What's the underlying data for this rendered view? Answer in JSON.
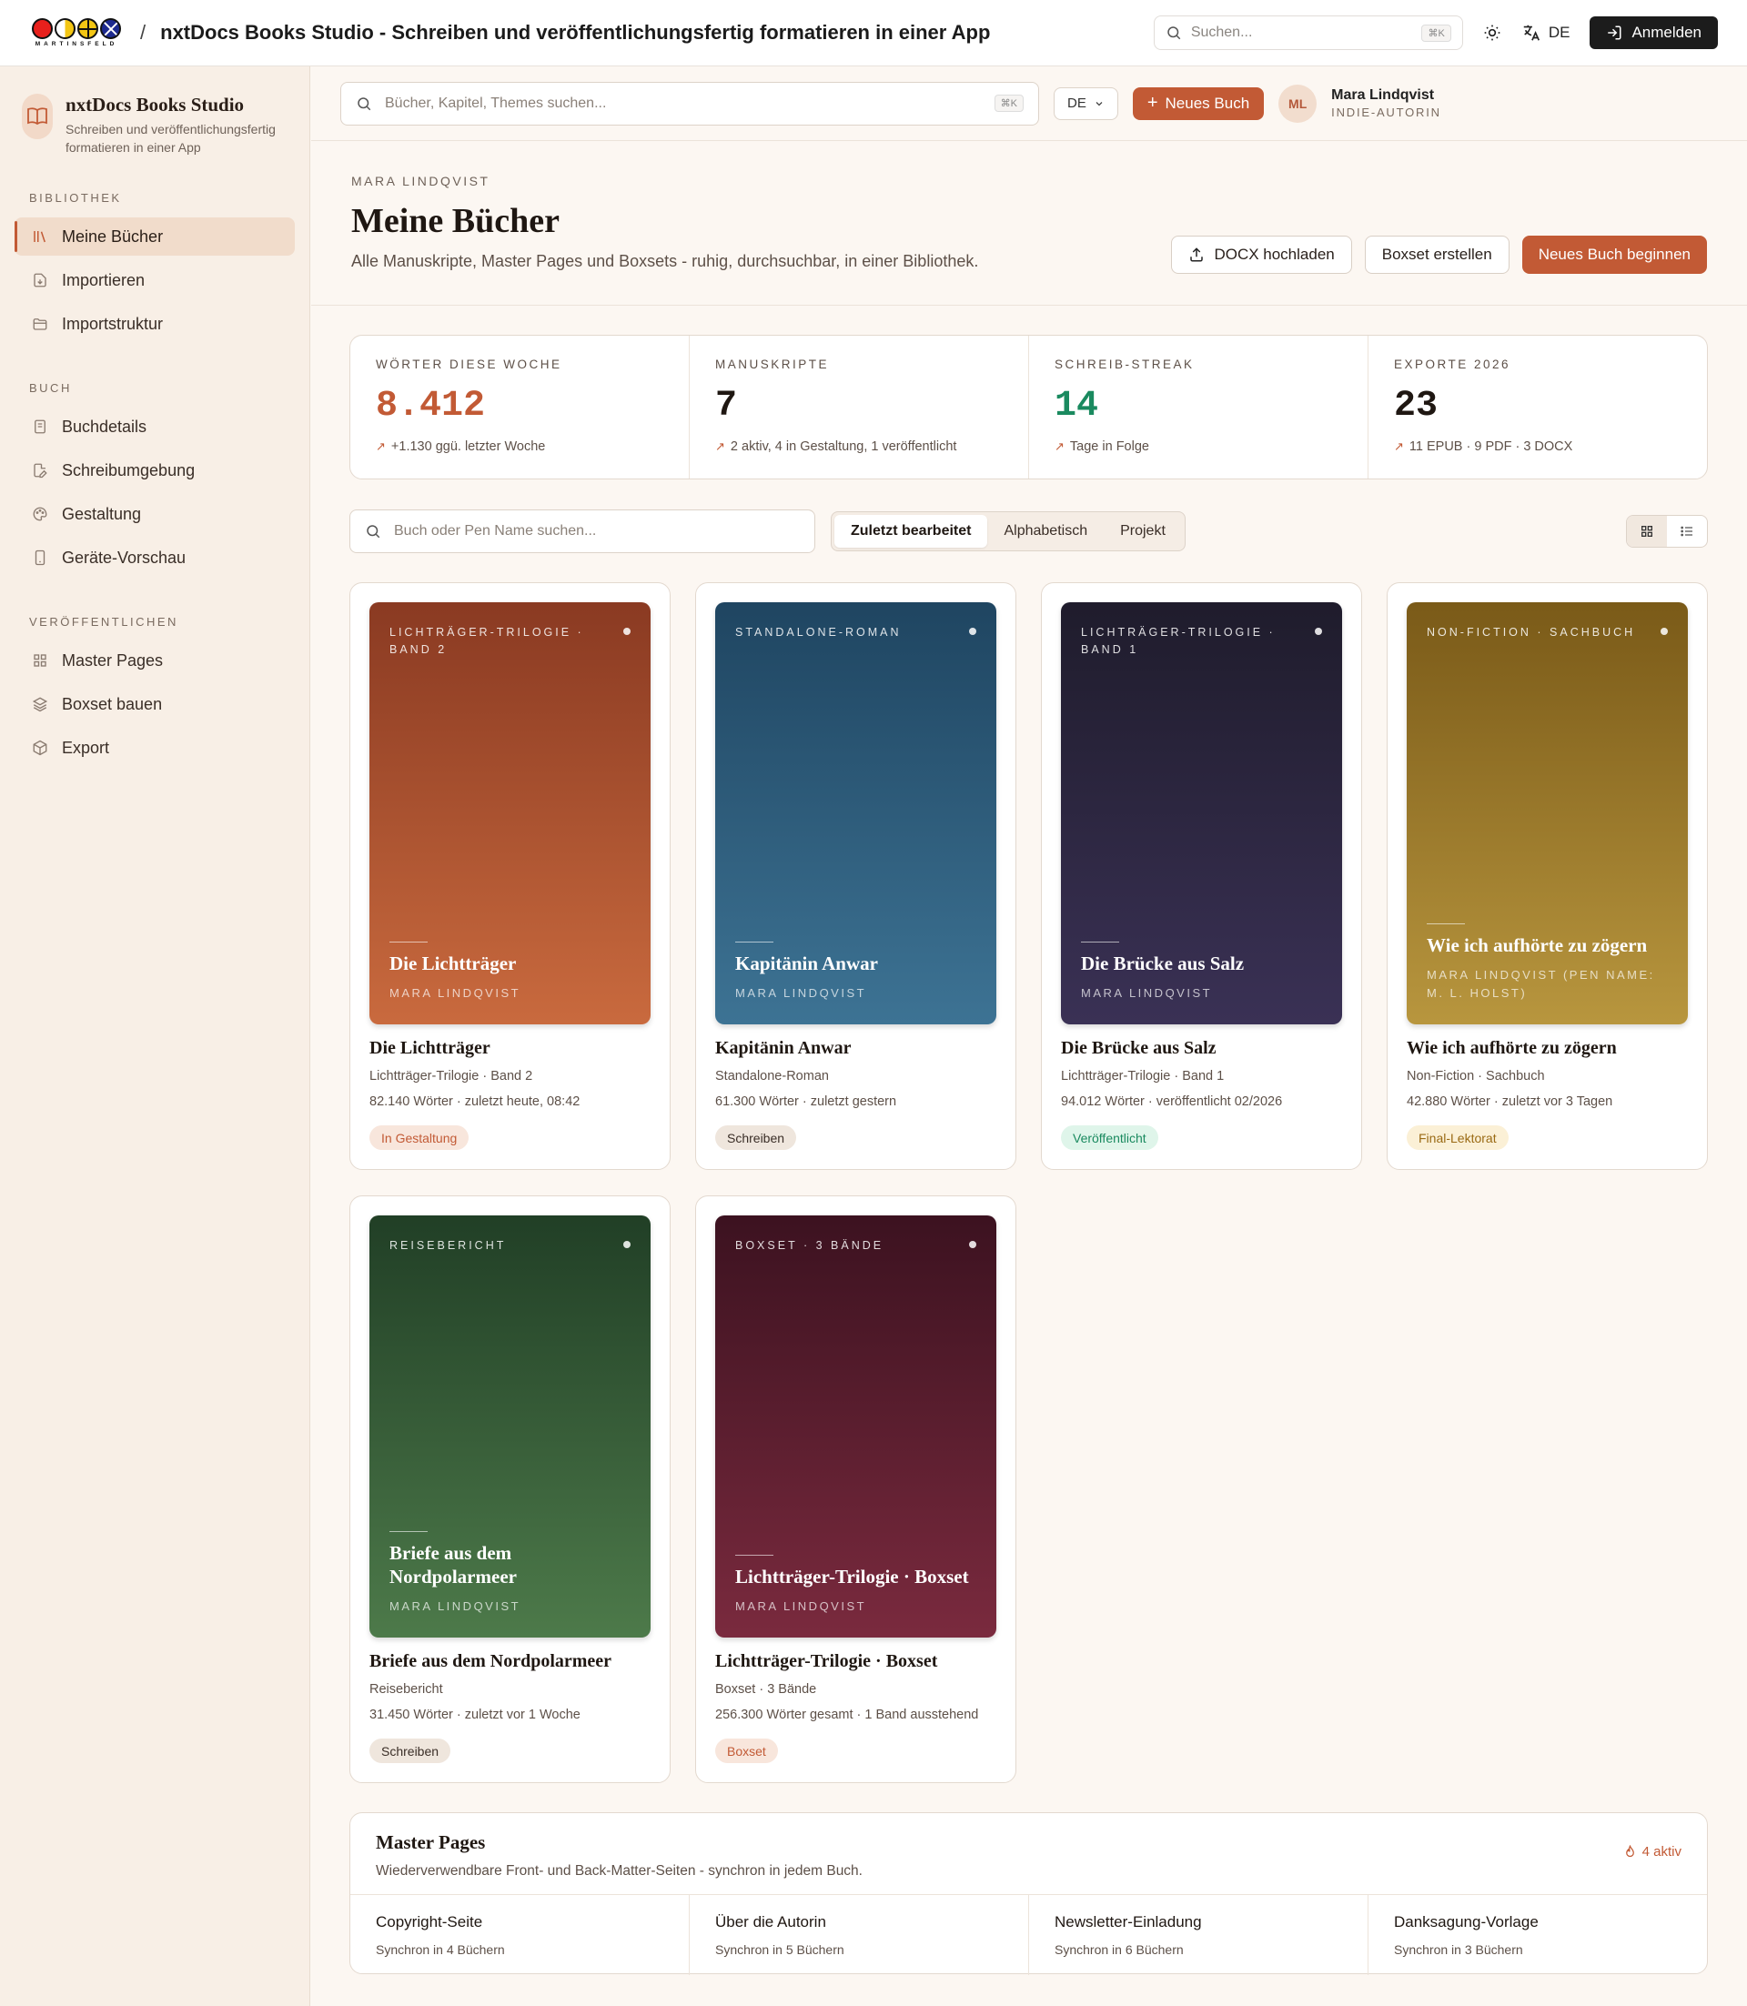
{
  "app": {
    "logo_word": "MARTINSFELD",
    "title": "nxtDocs Books Studio - Schreiben und veröffentlichungsfertig formatieren in einer App",
    "search_placeholder": "Suchen...",
    "search_kbd": "⌘K",
    "lang": "DE",
    "login_label": "Anmelden",
    "logo_colors": [
      "#e8201c",
      "#f3c614",
      "#f3c614",
      "#1d2a8f"
    ]
  },
  "sidebar": {
    "brand_name": "nxtDocs Books Studio",
    "brand_sub": "Schreiben und veröffentlichungsfertig formatieren in einer App",
    "sections": [
      {
        "heading": "BIBLIOTHEK",
        "items": [
          {
            "label": "Meine Bücher",
            "icon": "library-icon",
            "active": true
          },
          {
            "label": "Importieren",
            "icon": "file-import-icon"
          },
          {
            "label": "Importstruktur",
            "icon": "folder-open-icon"
          }
        ]
      },
      {
        "heading": "BUCH",
        "items": [
          {
            "label": "Buchdetails",
            "icon": "book-details-icon"
          },
          {
            "label": "Schreibumgebung",
            "icon": "edit-file-icon"
          },
          {
            "label": "Gestaltung",
            "icon": "palette-icon"
          },
          {
            "label": "Geräte-Vorschau",
            "icon": "device-icon"
          }
        ]
      },
      {
        "heading": "VERÖFFENTLICHEN",
        "items": [
          {
            "label": "Master Pages",
            "icon": "grid-icon"
          },
          {
            "label": "Boxset bauen",
            "icon": "layers-icon"
          },
          {
            "label": "Export",
            "icon": "package-icon"
          }
        ]
      }
    ]
  },
  "subbar": {
    "search_placeholder": "Bücher, Kapitel, Themes suchen...",
    "search_kbd": "⌘K",
    "lang": "DE",
    "new_book_label": "Neues Buch",
    "avatar_initials": "ML",
    "user_name": "Mara Lindqvist",
    "user_role": "INDIE-AUTORIN"
  },
  "header": {
    "kicker": "MARA LINDQVIST",
    "title": "Meine Bücher",
    "description": "Alle Manuskripte, Master Pages und Boxsets - ruhig, durchsuchbar, in einer Bibliothek.",
    "upload_label": "DOCX hochladen",
    "boxset_label": "Boxset erstellen",
    "new_label": "Neues Buch beginnen"
  },
  "stats": [
    {
      "label": "WÖRTER DIESE WOCHE",
      "value": "8.412",
      "note": "+1.130 ggü. letzter Woche",
      "color": "#c25a35"
    },
    {
      "label": "MANUSKRIPTE",
      "value": "7",
      "note": "2 aktiv, 4 in Gestaltung, 1 veröffentlicht",
      "color": "#1f1712"
    },
    {
      "label": "SCHREIB-STREAK",
      "value": "14",
      "note": "Tage in Folge",
      "color": "#1a8a5f"
    },
    {
      "label": "EXPORTE 2026",
      "value": "23",
      "note": "11 EPUB · 9 PDF · 3 DOCX",
      "color": "#1f1712"
    }
  ],
  "filters": {
    "search_placeholder": "Buch oder Pen Name suchen...",
    "sort_options": [
      "Zuletzt bearbeitet",
      "Alphabetisch",
      "Projekt"
    ]
  },
  "books": [
    {
      "series_label": "LICHTRÄGER-TRILOGIE · BAND 2",
      "cover_title": "Die Lichtträger",
      "cover_author": "MARA LINDQVIST",
      "title": "Die Lichtträger",
      "series": "Lichtträger-Trilogie · Band 2",
      "meta": "82.140 Wörter · zuletzt heute, 08:42",
      "status": "In Gestaltung",
      "gradient": [
        "#8a3a22",
        "#c96a3e"
      ],
      "badge_bg": "#f8e6dc",
      "badge_fg": "#c25a35"
    },
    {
      "series_label": "STANDALONE-ROMAN",
      "cover_title": "Kapitänin Anwar",
      "cover_author": "MARA LINDQVIST",
      "title": "Kapitänin Anwar",
      "series": "Standalone-Roman",
      "meta": "61.300 Wörter · zuletzt gestern",
      "status": "Schreiben",
      "gradient": [
        "#1f4561",
        "#3d7394"
      ],
      "badge_bg": "#efe6dd",
      "badge_fg": "#3a2e27"
    },
    {
      "series_label": "LICHTRÄGER-TRILOGIE · BAND 1",
      "cover_title": "Die Brücke aus Salz",
      "cover_author": "MARA LINDQVIST",
      "title": "Die Brücke aus Salz",
      "series": "Lichtträger-Trilogie · Band 1",
      "meta": "94.012 Wörter · veröffentlicht 02/2026",
      "status": "Veröffentlicht",
      "gradient": [
        "#1f1c2c",
        "#3a3155"
      ],
      "badge_bg": "#dff5ea",
      "badge_fg": "#1a8a5f"
    },
    {
      "series_label": "NON-FICTION · SACHBUCH",
      "cover_title": "Wie ich aufhörte zu zögern",
      "cover_author": "MARA LINDQVIST (PEN NAME: M. L. HOLST)",
      "title": "Wie ich aufhörte zu zögern",
      "series": "Non-Fiction · Sachbuch",
      "meta": "42.880 Wörter · zuletzt vor 3 Tagen",
      "status": "Final-Lektorat",
      "gradient": [
        "#7a5a18",
        "#b8963e"
      ],
      "badge_bg": "#fbf0d6",
      "badge_fg": "#9a6a14"
    },
    {
      "series_label": "REISEBERICHT",
      "cover_title": "Briefe aus dem Nordpolarmeer",
      "cover_author": "MARA LINDQVIST",
      "title": "Briefe aus dem Nordpolarmeer",
      "series": "Reisebericht",
      "meta": "31.450 Wörter · zuletzt vor 1 Woche",
      "status": "Schreiben",
      "gradient": [
        "#213f26",
        "#4d7a4a"
      ],
      "badge_bg": "#efe6dd",
      "badge_fg": "#3a2e27"
    },
    {
      "series_label": "BOXSET · 3 BÄNDE",
      "cover_title": "Lichtträger-Trilogie · Boxset",
      "cover_author": "MARA LINDQVIST",
      "title": "Lichtträger-Trilogie · Boxset",
      "series": "Boxset · 3 Bände",
      "meta": "256.300 Wörter gesamt · 1 Band ausstehend",
      "status": "Boxset",
      "gradient": [
        "#3c1220",
        "#7a2a3e"
      ],
      "badge_bg": "#f8e6dc",
      "badge_fg": "#c25a35"
    }
  ],
  "master_pages": {
    "title": "Master Pages",
    "description": "Wiederverwendbare Front- und Back-Matter-Seiten - synchron in jedem Buch.",
    "count_label": "4 aktiv",
    "items": [
      {
        "title": "Copyright-Seite",
        "sub": "Synchron in 4 Büchern"
      },
      {
        "title": "Über die Autorin",
        "sub": "Synchron in 5 Büchern"
      },
      {
        "title": "Newsletter-Einladung",
        "sub": "Synchron in 6 Büchern"
      },
      {
        "title": "Danksagung-Vorlage",
        "sub": "Synchron in 3 Büchern"
      }
    ]
  }
}
